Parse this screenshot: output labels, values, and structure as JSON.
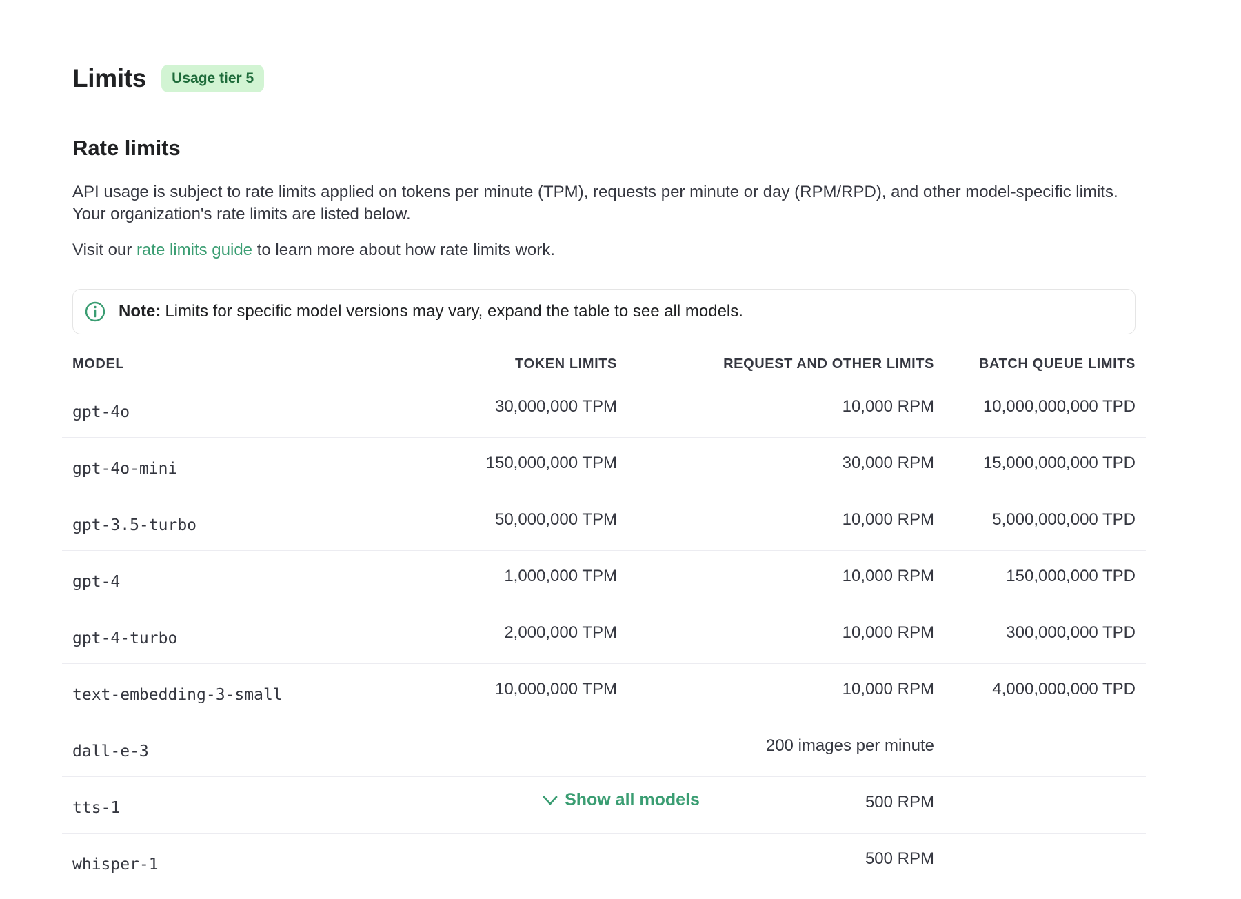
{
  "header": {
    "title": "Limits",
    "tier_badge": "Usage tier 5"
  },
  "rate_limits": {
    "heading": "Rate limits",
    "description": "API usage is subject to rate limits applied on tokens per minute (TPM), requests per minute or day (RPM/RPD), and other model-specific limits. Your organization's rate limits are listed below.",
    "visit_prefix": "Visit our",
    "guide_link": "rate limits guide",
    "visit_suffix": "to learn more about how rate limits work."
  },
  "note": {
    "icon": "info-icon",
    "label": "Note:",
    "text": "Limits for specific model versions may vary, expand the table to see all models."
  },
  "colors": {
    "accent": "#3a9d72",
    "badge_bg": "#d2f4d3"
  },
  "table": {
    "columns": [
      "MODEL",
      "TOKEN LIMITS",
      "REQUEST AND OTHER LIMITS",
      "BATCH QUEUE LIMITS"
    ],
    "rows": [
      {
        "model": "gpt-4o",
        "token": "30,000,000 TPM",
        "request": "10,000 RPM",
        "batch": "10,000,000,000 TPD"
      },
      {
        "model": "gpt-4o-mini",
        "token": "150,000,000 TPM",
        "request": "30,000 RPM",
        "batch": "15,000,000,000 TPD"
      },
      {
        "model": "gpt-3.5-turbo",
        "token": "50,000,000 TPM",
        "request": "10,000 RPM",
        "batch": "5,000,000,000 TPD"
      },
      {
        "model": "gpt-4",
        "token": "1,000,000 TPM",
        "request": "10,000 RPM",
        "batch": "150,000,000 TPD"
      },
      {
        "model": "gpt-4-turbo",
        "token": "2,000,000 TPM",
        "request": "10,000 RPM",
        "batch": "300,000,000 TPD"
      },
      {
        "model": "text-embedding-3-small",
        "token": "10,000,000 TPM",
        "request": "10,000 RPM",
        "batch": "4,000,000,000 TPD"
      },
      {
        "model": "dall-e-3",
        "token": "",
        "request": "200 images per minute",
        "batch": ""
      },
      {
        "model": "tts-1",
        "token": "",
        "request": "500 RPM",
        "batch": ""
      },
      {
        "model": "whisper-1",
        "token": "",
        "request": "500 RPM",
        "batch": ""
      }
    ]
  },
  "show_all": {
    "icon": "chevron-down-icon",
    "label": "Show all models"
  }
}
